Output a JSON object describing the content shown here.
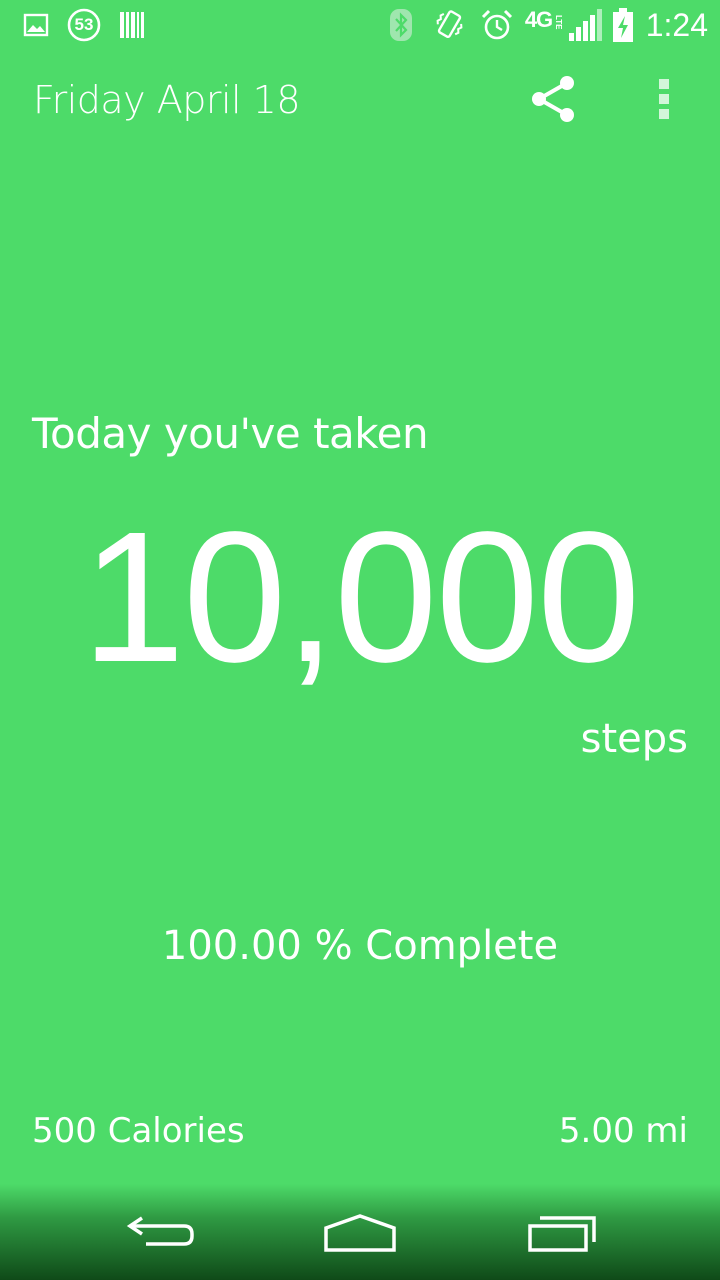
{
  "status_bar": {
    "notification_badge": "53",
    "network_type": "4G",
    "time": "1:24",
    "icons": [
      "gallery-icon",
      "counter-badge-icon",
      "barcode-icon",
      "bluetooth-icon",
      "vibrate-icon",
      "alarm-icon",
      "lte-icon",
      "signal-icon",
      "battery-charging-icon"
    ]
  },
  "app_bar": {
    "date": "Friday April 18",
    "share_icon": "share-icon",
    "overflow_icon": "overflow-menu-icon"
  },
  "main": {
    "intro": "Today you've taken",
    "step_count": "10,000",
    "unit": "steps",
    "progress": "100.00 % Complete",
    "calories": "500 Calories",
    "distance": "5.00 mi"
  },
  "nav_bar": {
    "back_icon": "back-icon",
    "home_icon": "home-icon",
    "recents_icon": "recent-apps-icon"
  },
  "colors": {
    "background": "#4ddb69",
    "text": "#ffffff"
  }
}
